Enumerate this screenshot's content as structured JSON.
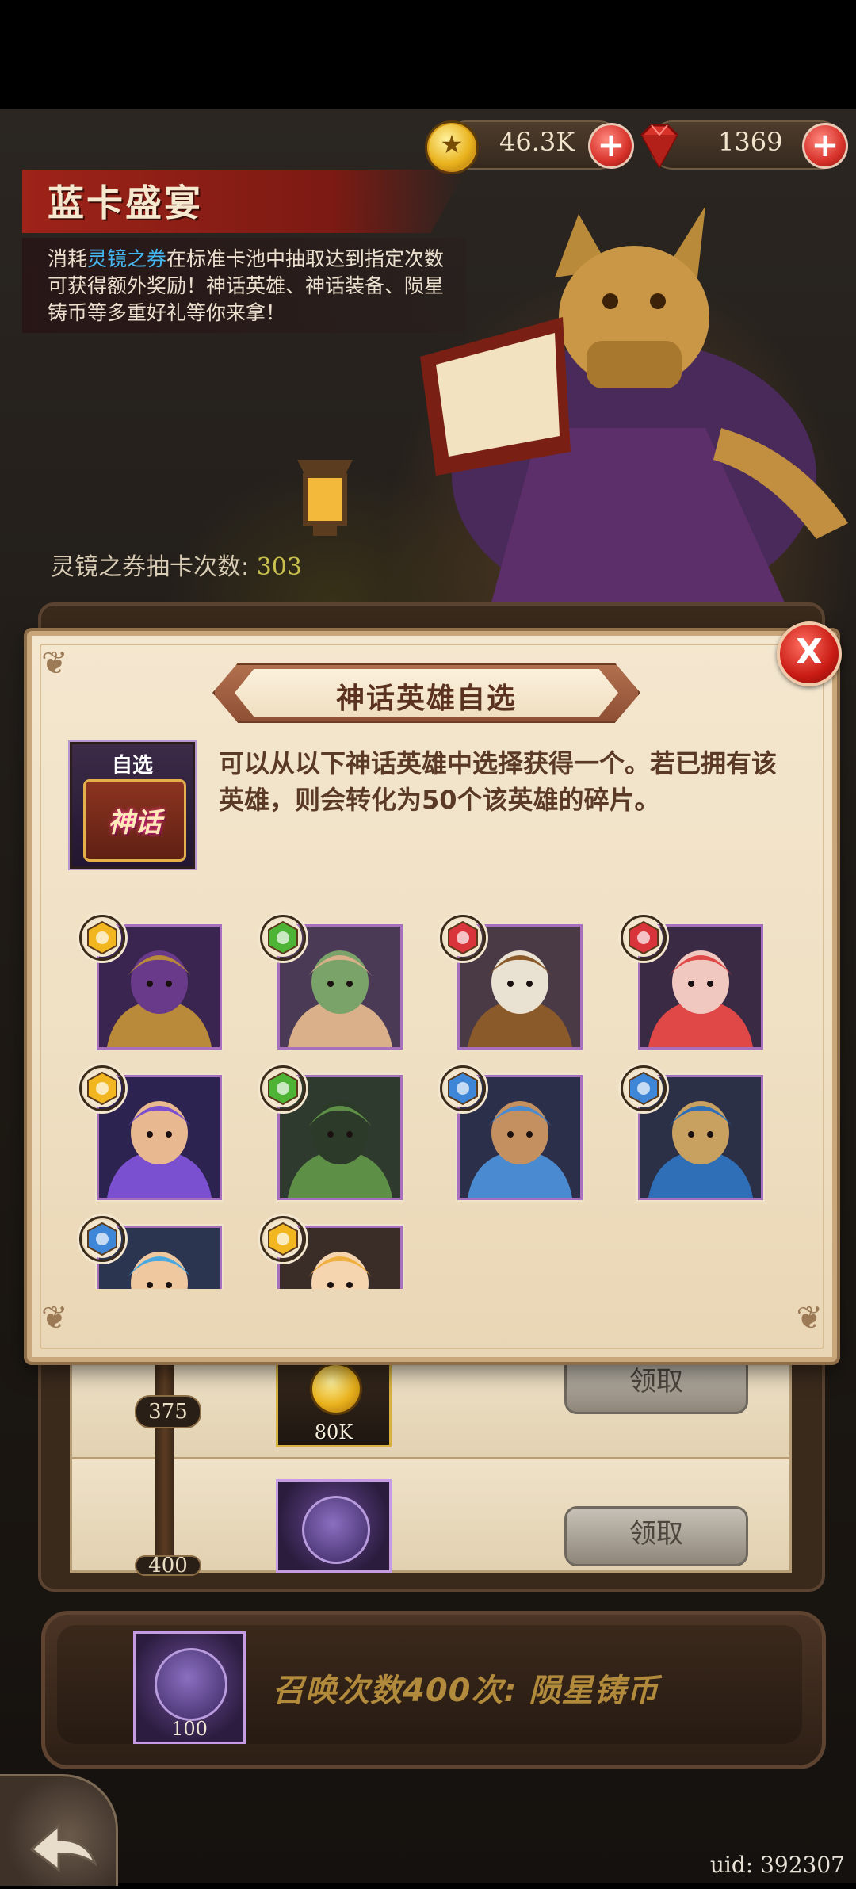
{
  "currency": {
    "gold": "46.3K",
    "gems": "1369",
    "colors": {
      "gold": "#e9b21d",
      "gem": "#d7322a"
    }
  },
  "event": {
    "title": "蓝卡盛宴",
    "description_pre": "消耗",
    "description_highlight": "灵镜之券",
    "description_post": "在标准卡池中抽取达到指定次数可获得额外奖励！神话英雄、神话装备、陨星铸币等多重好礼等你来拿！",
    "draw_count_label": "灵镜之券抽卡次数: ",
    "draw_count_value": "303"
  },
  "milestones": [
    {
      "level": "375",
      "reward_amount": "80K",
      "reward_icon": "gold-coin-icon",
      "button": "领取"
    },
    {
      "level": "400",
      "reward_icon": "meteor-coin-icon",
      "button": "领取"
    }
  ],
  "summary": {
    "reward_count": "100",
    "text": "召唤次数400次: 陨星铸币"
  },
  "uid": "uid: 392307",
  "dialog": {
    "title": "神话英雄自选",
    "choose_tag": "自选",
    "chest_label": "神话",
    "info": "可以从以下神话英雄中选择获得一个。若已拥有该英雄，则会转化为50个该英雄的碎片。",
    "close_label": "X",
    "heroes": [
      {
        "faction": "gold",
        "portrait": "dragonkin-scholar"
      },
      {
        "faction": "green",
        "portrait": "elder-dwarf"
      },
      {
        "faction": "red",
        "portrait": "desert-warrior"
      },
      {
        "faction": "red",
        "portrait": "crimson-spirit"
      },
      {
        "faction": "gold",
        "portrait": "violet-sorceress"
      },
      {
        "faction": "green",
        "portrait": "green-orc-lady"
      },
      {
        "faction": "blue",
        "portrait": "horned-swordsman"
      },
      {
        "faction": "blue",
        "portrait": "elf-mage"
      },
      {
        "faction": "blue",
        "portrait": "blue-haired-hero"
      },
      {
        "faction": "gold",
        "portrait": "blonde-girl"
      }
    ],
    "faction_colors": {
      "gold": "#f2b720",
      "green": "#4db435",
      "red": "#d9343b",
      "blue": "#3d86d8"
    }
  }
}
